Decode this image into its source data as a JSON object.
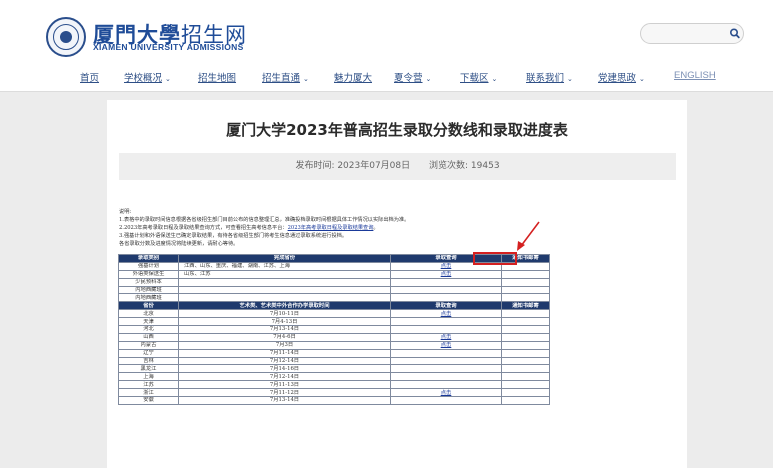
{
  "header": {
    "logo_cn_bold": "厦門大學",
    "logo_cn_thin": "招生网",
    "logo_en": "XIAMEN UNIVERSITY ADMISSIONS",
    "search_placeholder": ""
  },
  "nav": [
    {
      "label": "首页",
      "dropdown": false
    },
    {
      "label": "学校概况",
      "dropdown": true
    },
    {
      "label": "招生地图",
      "dropdown": false
    },
    {
      "label": "招生直通",
      "dropdown": true
    },
    {
      "label": "魅力厦大",
      "dropdown": false
    },
    {
      "label": "夏令营",
      "dropdown": true
    },
    {
      "label": "下载区",
      "dropdown": true
    },
    {
      "label": "联系我们",
      "dropdown": true
    },
    {
      "label": "党建思政",
      "dropdown": true
    },
    {
      "label": "ENGLISH",
      "dropdown": false
    }
  ],
  "article": {
    "title": "厦门大学2023年普高招生录取分数线和录取进度表",
    "publish_label": "发布时间: 2023年07月08日",
    "views_label": "浏览次数: 19453"
  },
  "notes": {
    "line1": "说明:",
    "line2": "1.表格中的录取时间信息根据各省级招生部门目前公布的信息整理汇总，准确投档录取时间根据具体工作情况以实际出档为准。",
    "line3_prefix": "2.2023年高考录取日程及录取结果查询方式，可查看招生高考信息平台：",
    "line3_link": "2023年高考录取日程及录取结果查询",
    "line3_suffix": "。",
    "line4": "3.强基计划和外语保送生已确定录取结果，有待各省级招生部门将考生信息通过录取系统进行投档。",
    "line5": "各省录取分数及进度情况将陆续更新，请耐心等待。"
  },
  "table1": {
    "headers": [
      "录取类别",
      "完成省份",
      "录取查询",
      "通知书邮寄"
    ],
    "rows": [
      {
        "category": "强基计划",
        "provinces": "江西、山东、重庆、福建、湖南、江苏、上海",
        "query": "点击",
        "mail": ""
      },
      {
        "category": "外语类保送生",
        "provinces": "山东、江苏",
        "query": "点击",
        "mail": ""
      },
      {
        "category": "少民预科本",
        "provinces": "",
        "query": "",
        "mail": ""
      },
      {
        "category": "内地西藏班",
        "provinces": "",
        "query": "",
        "mail": ""
      },
      {
        "category": "内地西藏班",
        "provinces": "",
        "query": "",
        "mail": ""
      }
    ]
  },
  "table2": {
    "headers": [
      "省份",
      "艺术类、艺术类中外合作办学录取时间",
      "录取查询",
      "通知书邮寄"
    ],
    "rows": [
      {
        "province": "北京",
        "time": "7月10-11日",
        "query": "点击",
        "mail": ""
      },
      {
        "province": "天津",
        "time": "7月4-13日",
        "query": "",
        "mail": ""
      },
      {
        "province": "河北",
        "time": "7月13-14日",
        "query": "",
        "mail": ""
      },
      {
        "province": "山西",
        "time": "7月4-6日",
        "query": "点击",
        "mail": ""
      },
      {
        "province": "内蒙古",
        "time": "7月3日",
        "query": "点击",
        "mail": ""
      },
      {
        "province": "辽宁",
        "time": "7月11-14日",
        "query": "",
        "mail": ""
      },
      {
        "province": "吉林",
        "time": "7月12-14日",
        "query": "",
        "mail": ""
      },
      {
        "province": "黑龙江",
        "time": "7月14-16日",
        "query": "",
        "mail": ""
      },
      {
        "province": "上海",
        "time": "7月12-14日",
        "query": "",
        "mail": ""
      },
      {
        "province": "江苏",
        "time": "7月11-13日",
        "query": "",
        "mail": ""
      },
      {
        "province": "浙江",
        "time": "7月11-12日",
        "query": "点击",
        "mail": ""
      },
      {
        "province": "安徽",
        "time": "7月13-14日",
        "query": "",
        "mail": ""
      }
    ]
  },
  "colors": {
    "brand": "#1f4c98",
    "table_header": "#1f3a6d",
    "highlight": "#d42020"
  },
  "icons": {
    "search": "search-icon",
    "seal": "university-seal-icon",
    "arrow": "red-arrow-annotation"
  }
}
